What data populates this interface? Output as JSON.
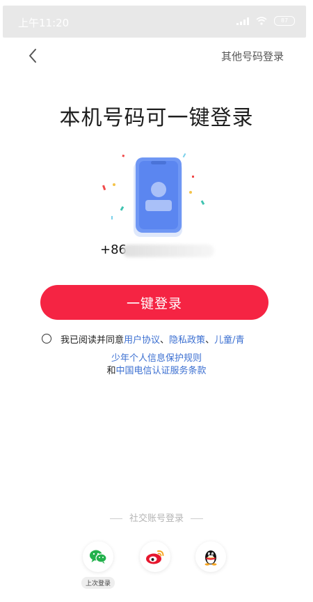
{
  "status_bar": {
    "time": "上午11:20",
    "battery": "87"
  },
  "nav": {
    "other_login_label": "其他号码登录"
  },
  "title": "本机号码可一键登录",
  "phone": {
    "prefix": "+86"
  },
  "login_button_label": "一键登录",
  "agreement": {
    "prefix": "我已阅读并同意",
    "user_agreement": "用户协议",
    "sep1": "、",
    "privacy_policy": "隐私政策",
    "sep2": "、",
    "minor_policy_part1": "儿童/青",
    "minor_policy_part2": "少年个人信息保护规则",
    "and": "和",
    "telecom_terms": "中国电信认证服务条款"
  },
  "social": {
    "divider_label": "社交账号登录",
    "last_login_label": "上次登录",
    "icons": [
      "wechat-icon",
      "weibo-icon",
      "qq-icon"
    ]
  },
  "colors": {
    "primary": "#f52443",
    "link": "#3b6fd1",
    "wechat": "#22b14c",
    "weibo": "#e6162d"
  }
}
